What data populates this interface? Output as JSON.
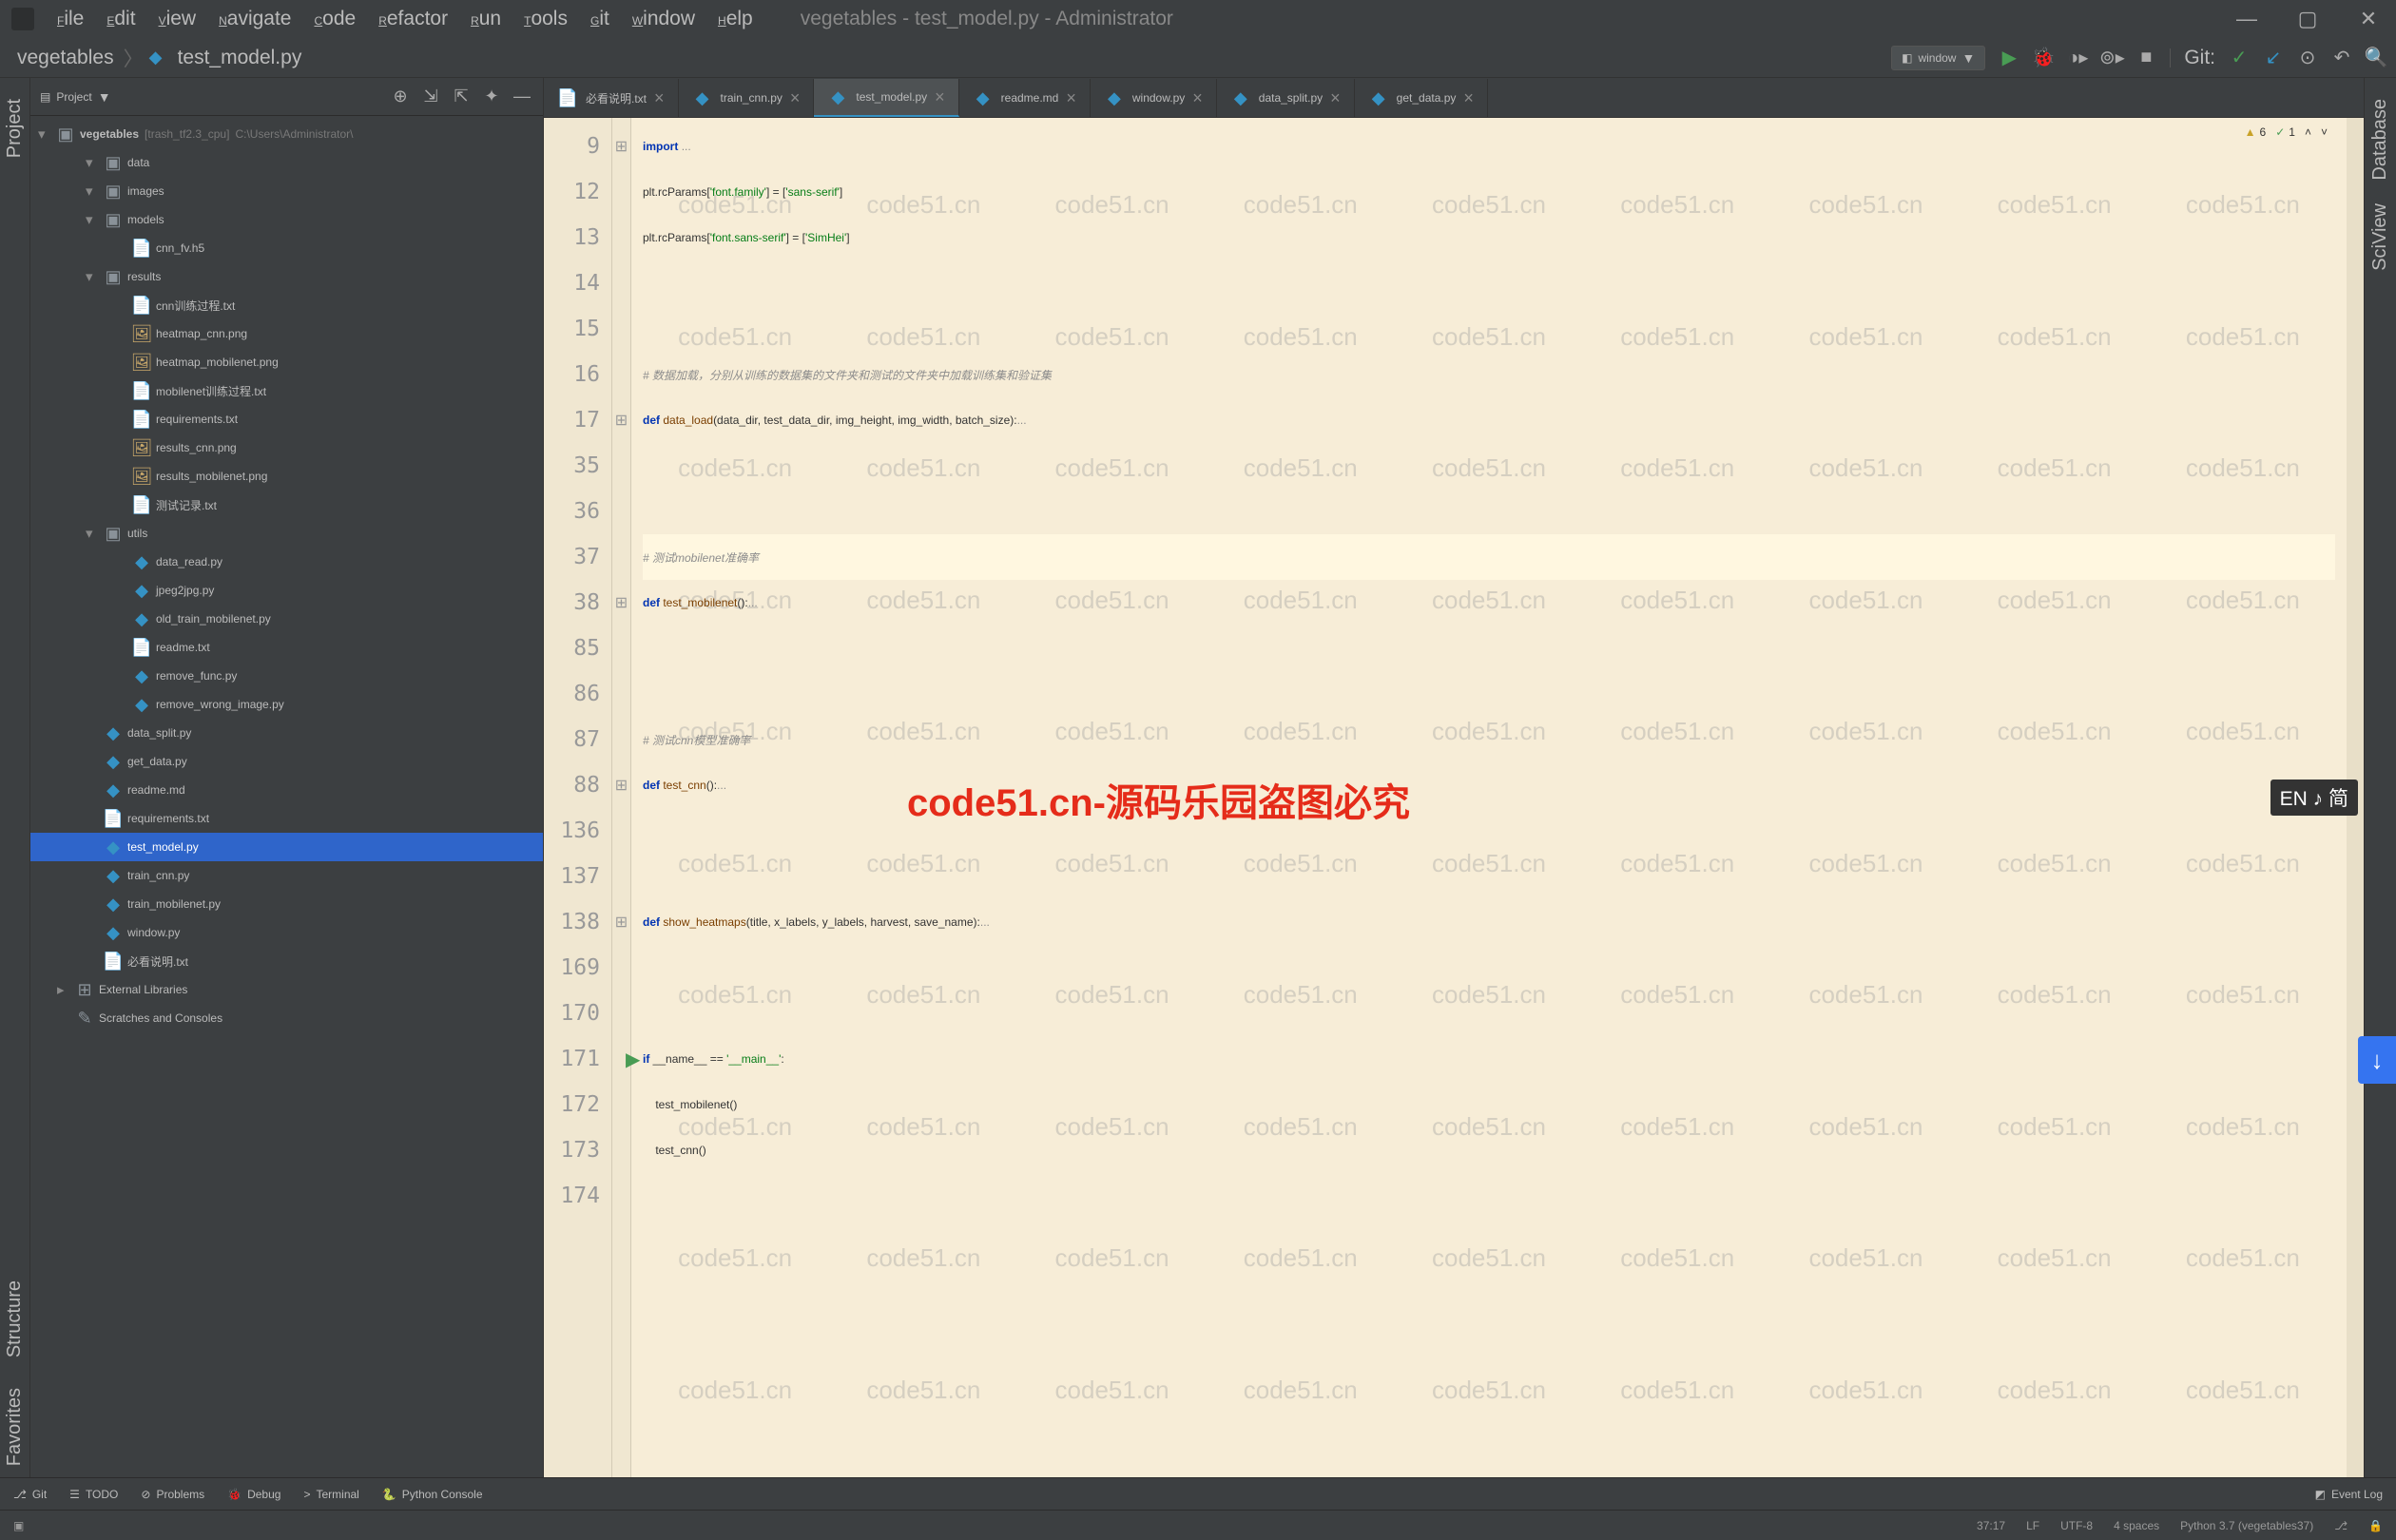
{
  "window": {
    "title": "vegetables - test_model.py - Administrator"
  },
  "menu": [
    "File",
    "Edit",
    "View",
    "Navigate",
    "Code",
    "Refactor",
    "Run",
    "Tools",
    "Git",
    "Window",
    "Help"
  ],
  "breadcrumb": [
    "vegetables",
    "test_model.py"
  ],
  "runConfig": "window",
  "gitLabel": "Git:",
  "project": {
    "title": "Project",
    "root": {
      "name": "vegetables",
      "hint": "[trash_tf2.3_cpu]",
      "path": "C:\\Users\\Administrator\\"
    },
    "tree": [
      {
        "d": 1,
        "type": "folder",
        "name": "data",
        "open": true
      },
      {
        "d": 1,
        "type": "folder",
        "name": "images",
        "open": true
      },
      {
        "d": 1,
        "type": "folder",
        "name": "models",
        "open": true
      },
      {
        "d": 2,
        "type": "file",
        "icon": "txt",
        "name": "cnn_fv.h5"
      },
      {
        "d": 1,
        "type": "folder",
        "name": "results",
        "open": true
      },
      {
        "d": 2,
        "type": "file",
        "icon": "txt",
        "name": "cnn训练过程.txt"
      },
      {
        "d": 2,
        "type": "file",
        "icon": "img",
        "name": "heatmap_cnn.png"
      },
      {
        "d": 2,
        "type": "file",
        "icon": "img",
        "name": "heatmap_mobilenet.png"
      },
      {
        "d": 2,
        "type": "file",
        "icon": "txt",
        "name": "mobilenet训练过程.txt"
      },
      {
        "d": 2,
        "type": "file",
        "icon": "txt",
        "name": "requirements.txt"
      },
      {
        "d": 2,
        "type": "file",
        "icon": "img",
        "name": "results_cnn.png"
      },
      {
        "d": 2,
        "type": "file",
        "icon": "img",
        "name": "results_mobilenet.png"
      },
      {
        "d": 2,
        "type": "file",
        "icon": "txt",
        "name": "测试记录.txt"
      },
      {
        "d": 1,
        "type": "folder",
        "name": "utils",
        "open": true
      },
      {
        "d": 2,
        "type": "file",
        "icon": "py",
        "name": "data_read.py"
      },
      {
        "d": 2,
        "type": "file",
        "icon": "py",
        "name": "jpeg2jpg.py"
      },
      {
        "d": 2,
        "type": "file",
        "icon": "py",
        "name": "old_train_mobilenet.py"
      },
      {
        "d": 2,
        "type": "file",
        "icon": "txt",
        "name": "readme.txt"
      },
      {
        "d": 2,
        "type": "file",
        "icon": "py",
        "name": "remove_func.py"
      },
      {
        "d": 2,
        "type": "file",
        "icon": "py",
        "name": "remove_wrong_image.py"
      },
      {
        "d": 1,
        "type": "file",
        "icon": "py",
        "name": "data_split.py"
      },
      {
        "d": 1,
        "type": "file",
        "icon": "py",
        "name": "get_data.py"
      },
      {
        "d": 1,
        "type": "file",
        "icon": "md",
        "name": "readme.md"
      },
      {
        "d": 1,
        "type": "file",
        "icon": "txt",
        "name": "requirements.txt"
      },
      {
        "d": 1,
        "type": "file",
        "icon": "py",
        "name": "test_model.py",
        "selected": true
      },
      {
        "d": 1,
        "type": "file",
        "icon": "py",
        "name": "train_cnn.py"
      },
      {
        "d": 1,
        "type": "file",
        "icon": "py",
        "name": "train_mobilenet.py"
      },
      {
        "d": 1,
        "type": "file",
        "icon": "py",
        "name": "window.py"
      },
      {
        "d": 1,
        "type": "file",
        "icon": "txt",
        "name": "必看说明.txt"
      },
      {
        "d": 0,
        "type": "lib",
        "name": "External Libraries"
      },
      {
        "d": 0,
        "type": "scr",
        "name": "Scratches and Consoles"
      }
    ]
  },
  "tabs": [
    {
      "icon": "txt",
      "label": "必看说明.txt"
    },
    {
      "icon": "py",
      "label": "train_cnn.py"
    },
    {
      "icon": "py",
      "label": "test_model.py",
      "active": true
    },
    {
      "icon": "md",
      "label": "readme.md"
    },
    {
      "icon": "py",
      "label": "window.py"
    },
    {
      "icon": "py",
      "label": "data_split.py"
    },
    {
      "icon": "py",
      "label": "get_data.py"
    }
  ],
  "inspections": {
    "warnings": "6",
    "weak": "1"
  },
  "code": {
    "lines": [
      {
        "n": "9",
        "t": [
          {
            "c": "kw",
            "s": "import"
          },
          {
            "c": "op",
            "s": " "
          },
          {
            "c": "fold-dots",
            "s": "..."
          }
        ]
      },
      {
        "n": "12",
        "t": [
          {
            "c": "op",
            "s": "plt.rcParams["
          },
          {
            "c": "str",
            "s": "'font.family'"
          },
          {
            "c": "op",
            "s": "] = ["
          },
          {
            "c": "str",
            "s": "'sans-serif'"
          },
          {
            "c": "op",
            "s": "]"
          }
        ]
      },
      {
        "n": "13",
        "t": [
          {
            "c": "op",
            "s": "plt.rcParams["
          },
          {
            "c": "str",
            "s": "'font.sans-serif'"
          },
          {
            "c": "op",
            "s": "] = ["
          },
          {
            "c": "str",
            "s": "'SimHei'"
          },
          {
            "c": "op",
            "s": "]"
          }
        ]
      },
      {
        "n": "14",
        "t": []
      },
      {
        "n": "15",
        "t": []
      },
      {
        "n": "16",
        "t": [
          {
            "c": "cm",
            "s": "# 数据加载，分别从训练的数据集的文件夹和测试的文件夹中加载训练集和验证集"
          }
        ]
      },
      {
        "n": "17",
        "t": [
          {
            "c": "kw",
            "s": "def"
          },
          {
            "c": "op",
            "s": " "
          },
          {
            "c": "fn",
            "s": "data_load"
          },
          {
            "c": "op",
            "s": "(data_dir, test_data_dir, img_height, img_width, batch_size):"
          },
          {
            "c": "fold-dots",
            "s": "..."
          }
        ]
      },
      {
        "n": "35",
        "t": []
      },
      {
        "n": "36",
        "t": []
      },
      {
        "n": "37",
        "hl": true,
        "t": [
          {
            "c": "cm",
            "s": "# 测试mobilenet准确率"
          }
        ]
      },
      {
        "n": "38",
        "t": [
          {
            "c": "kw",
            "s": "def"
          },
          {
            "c": "op",
            "s": " "
          },
          {
            "c": "fn",
            "s": "test_mobilenet"
          },
          {
            "c": "op",
            "s": "():"
          },
          {
            "c": "fold-dots",
            "s": "..."
          }
        ]
      },
      {
        "n": "85",
        "t": []
      },
      {
        "n": "86",
        "t": []
      },
      {
        "n": "87",
        "t": [
          {
            "c": "cm",
            "s": "# 测试cnn模型准确率"
          }
        ]
      },
      {
        "n": "88",
        "t": [
          {
            "c": "kw",
            "s": "def"
          },
          {
            "c": "op",
            "s": " "
          },
          {
            "c": "fn",
            "s": "test_cnn"
          },
          {
            "c": "op",
            "s": "():"
          },
          {
            "c": "fold-dots",
            "s": "..."
          }
        ]
      },
      {
        "n": "136",
        "t": []
      },
      {
        "n": "137",
        "t": []
      },
      {
        "n": "138",
        "t": [
          {
            "c": "kw",
            "s": "def"
          },
          {
            "c": "op",
            "s": " "
          },
          {
            "c": "fn",
            "s": "show_heatmaps"
          },
          {
            "c": "op",
            "s": "(title, x_labels, y_labels, harvest, save_name):"
          },
          {
            "c": "fold-dots",
            "s": "..."
          }
        ]
      },
      {
        "n": "169",
        "t": []
      },
      {
        "n": "170",
        "t": []
      },
      {
        "n": "171",
        "run": true,
        "t": [
          {
            "c": "kw",
            "s": "if"
          },
          {
            "c": "op",
            "s": " __name__ == "
          },
          {
            "c": "str",
            "s": "'__main__'"
          },
          {
            "c": "op",
            "s": ":"
          }
        ]
      },
      {
        "n": "172",
        "t": [
          {
            "c": "op",
            "s": "    test_mobilenet()"
          }
        ]
      },
      {
        "n": "173",
        "t": [
          {
            "c": "op",
            "s": "    test_cnn()"
          }
        ]
      },
      {
        "n": "174",
        "t": []
      }
    ]
  },
  "watermark": "code51.cn",
  "watermarkBig": "code51.cn-源码乐园盗图必究",
  "enBadge": "EN ♪ 简",
  "bottomTools": [
    {
      "icon": "⎇",
      "label": "Git"
    },
    {
      "icon": "☰",
      "label": "TODO"
    },
    {
      "icon": "⊘",
      "label": "Problems"
    },
    {
      "icon": "🐞",
      "label": "Debug"
    },
    {
      "icon": ">",
      "label": "Terminal"
    },
    {
      "icon": "🐍",
      "label": "Python Console"
    }
  ],
  "eventLog": "Event Log",
  "status": {
    "pos": "37:17",
    "lf": "LF",
    "enc": "UTF-8",
    "indent": "4 spaces",
    "interp": "Python 3.7 (vegetables37)"
  },
  "leftTabs": [
    "Project",
    "Structure",
    "Favorites"
  ],
  "rightTabs": [
    "Database",
    "SciView"
  ]
}
